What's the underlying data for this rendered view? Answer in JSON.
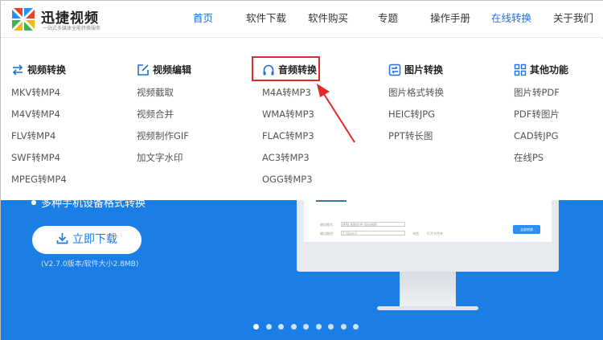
{
  "logo": {
    "title": "迅捷视频",
    "subtitle": "一站式多媒体全能转换服务"
  },
  "nav": [
    {
      "label": "首页",
      "active": true
    },
    {
      "label": "软件下载"
    },
    {
      "label": "软件购买"
    },
    {
      "label": "专题"
    },
    {
      "label": "操作手册"
    },
    {
      "label": "在线转换",
      "active": true
    },
    {
      "label": "关于我们"
    }
  ],
  "menu": [
    {
      "heading": "视频转换",
      "icon": "swap-arrows-icon",
      "items": [
        "MKV转MP4",
        "M4V转MP4",
        "FLV转MP4",
        "SWF转MP4",
        "MPEG转MP4"
      ]
    },
    {
      "heading": "视频编辑",
      "icon": "edit-icon",
      "items": [
        "视频截取",
        "视频合并",
        "视频制作GIF",
        "加文字水印"
      ]
    },
    {
      "heading": "音频转换",
      "icon": "headphones-icon",
      "items": [
        "M4A转MP3",
        "WMA转MP3",
        "FLAC转MP3",
        "AC3转MP3",
        "OGG转MP3"
      ]
    },
    {
      "heading": "图片转换",
      "icon": "image-swap-icon",
      "items": [
        "图片格式转换",
        "HEIC转JPG",
        "PPT转长图"
      ]
    },
    {
      "heading": "其他功能",
      "icon": "grid-icon",
      "items": [
        "图片转PDF",
        "PDF转图片",
        "CAD转JPG",
        "在线PS"
      ]
    }
  ],
  "hero": {
    "feature": "多种手机设备格式转换",
    "download_label": "立即下载",
    "version": "(V2.7.0版本/软件大小2.8MB)"
  },
  "mock_screen": {
    "output_format_label": "输出格式:",
    "output_format_value": "MP4 视频文件 同分辨率",
    "output_path_label": "输出路径:",
    "output_path_value": "C:\\Users\\",
    "browse_label": "浏览",
    "open_folder_label": "打开文件夹",
    "convert_all_label": "全部转换"
  },
  "carousel": {
    "dots": 9,
    "active_index": 0
  },
  "colors": {
    "accent": "#1e6fe0",
    "hero": "#1a7ee6",
    "highlight": "#e22a2a"
  }
}
